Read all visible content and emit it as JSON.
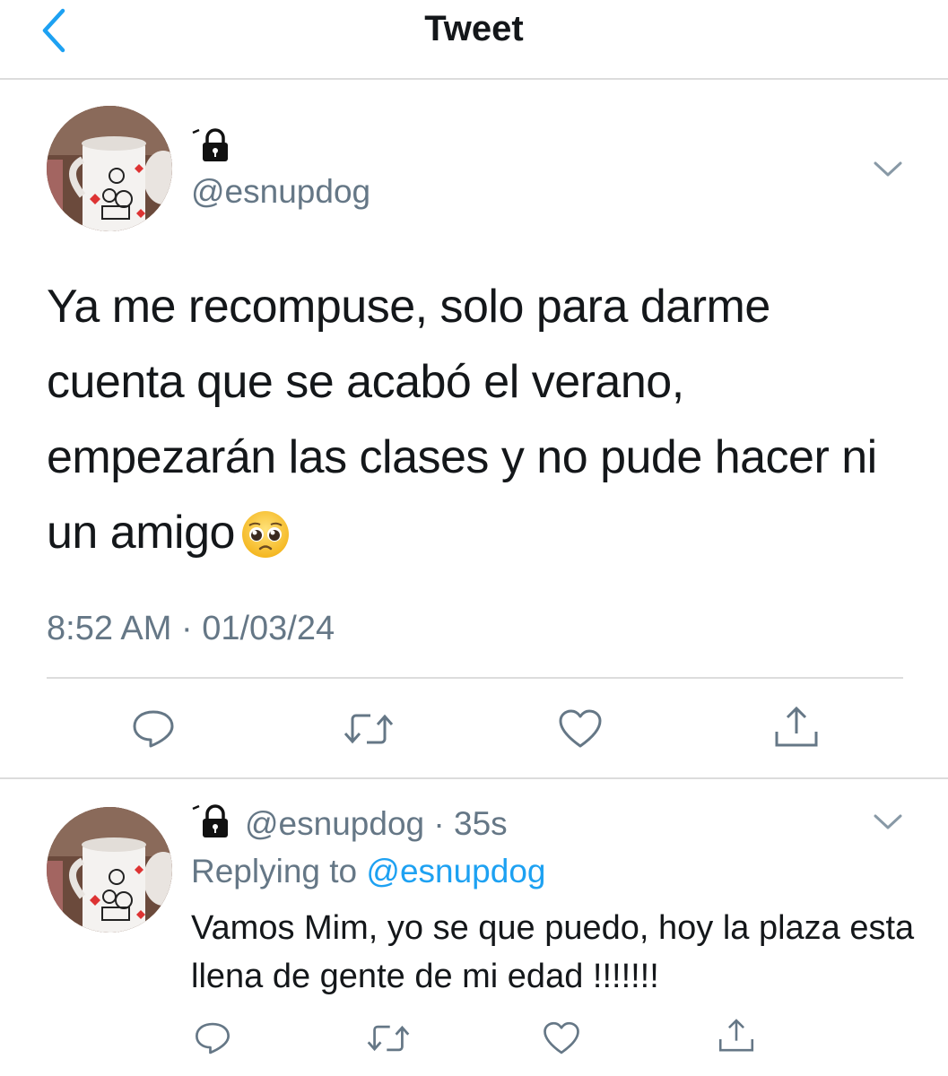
{
  "header": {
    "title": "Tweet",
    "back_icon": "chevron-left-icon"
  },
  "tweet": {
    "author_handle": "@esnupdog",
    "text": "Ya me recompuse, solo para darme cuenta que se acabó el verano, empezarán las clases y no pude hacer ni un amigo",
    "emoji": "pleading-face-emoji",
    "timestamp": "8:52 AM · 01/03/24",
    "actions": [
      "reply-icon",
      "retweet-icon",
      "like-icon",
      "share-icon"
    ]
  },
  "reply": {
    "author_handle": "@esnupdog",
    "time": "· 35s",
    "replying_prefix": "Replying to",
    "replying_to": "@esnupdog",
    "text": "Vamos Mim, yo se que puedo, hoy la plaza esta llena de gente de mi edad !!!!!!!",
    "actions": [
      "reply-icon",
      "retweet-icon",
      "like-icon",
      "share-icon"
    ]
  },
  "colors": {
    "accent": "#1da1f2",
    "secondary_text": "#657786",
    "primary_text": "#14171a",
    "back_arrow": "#1da1f2"
  }
}
